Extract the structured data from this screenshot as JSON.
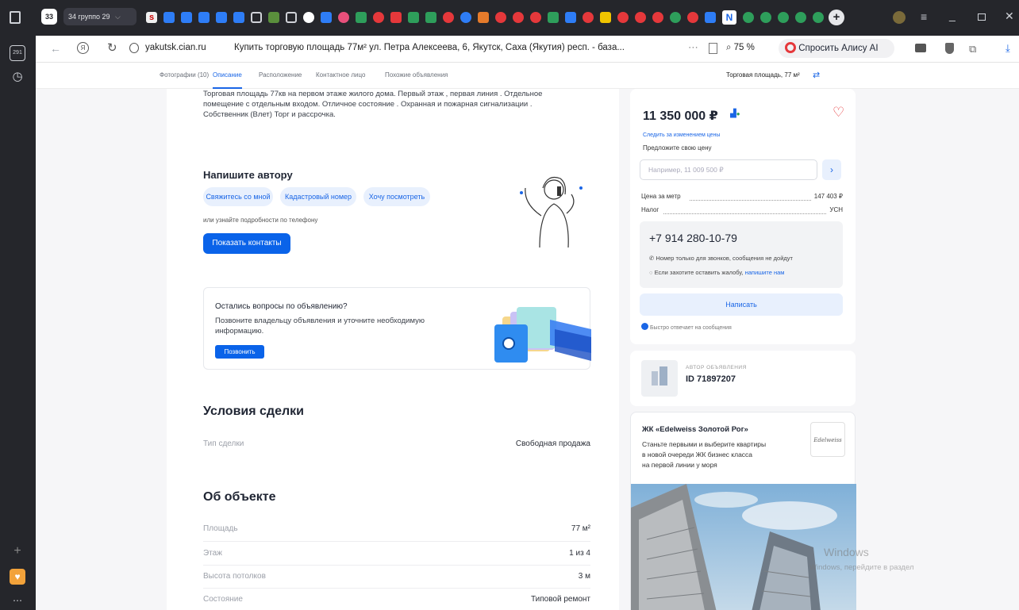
{
  "browser": {
    "tab_group": "34 группо 29",
    "tab_count": "33",
    "sidebar_badge": "291",
    "url": "yakutsk.cian.ru",
    "page_title": "Купить торговую площадь 77м² ул. Петра Алексеева, 6, Якутск, Саха (Якутия) респ. - база...",
    "zoom": "75 %",
    "alice_button": "Спросить Алису AI"
  },
  "subnav": {
    "links": [
      "Фотографии (10)",
      "Описание",
      "Расположение",
      "Контактное лицо",
      "Похожие объявления"
    ],
    "right_label": "Торговая площадь, 77 м²"
  },
  "description": {
    "text_line1": "Торговая площадь 77кв  на первом этаже жилого дома. Первый этаж , первая линия . Отдельное",
    "text_line2": "помещение с отдельным входом. Отличное состояние . Охранная и пожарная сигнализации .",
    "text_line3": "Собственник (Влет) Торг и рассрочка."
  },
  "write_author": {
    "title": "Напишите автору",
    "chips": [
      "Свяжитесь со мной",
      "Кадастровый номер",
      "Хочу посмотреть"
    ],
    "hint": "или узнайте подробности по телефону",
    "show_contacts": "Показать контакты"
  },
  "questions": {
    "title": "Остались вопросы по объявлению?",
    "text_line1": "Позвоните владельцу объявления и уточните необходимую",
    "text_line2": "информацию.",
    "call_button": "Позвонить"
  },
  "deal": {
    "title": "Условия сделки",
    "rows": [
      {
        "label": "Тип сделки",
        "value": "Свободная продажа"
      }
    ]
  },
  "object": {
    "title": "Об объекте",
    "rows": [
      {
        "label": "Площадь",
        "value": "77 м²"
      },
      {
        "label": "Этаж",
        "value": "1 из 4"
      },
      {
        "label": "Высота потолков",
        "value": "3 м"
      },
      {
        "label": "Состояние",
        "value": "Типовой ремонт"
      }
    ]
  },
  "price_card": {
    "price": "11 350 000 ₽",
    "follow_price": "Следить за изменением цены",
    "offer_label": "Предложите свою цену",
    "offer_placeholder": "Например, 11 009 500 ₽",
    "per_meter_label": "Цена за метр",
    "per_meter_value": "147 403 ₽",
    "tax_label": "Налог",
    "tax_value": "УСН",
    "phone": "+7 914 280-10-79",
    "phone_note1": "Номер только для звонков, сообщения не дойдут",
    "phone_note2_a": "Если захотите оставить жалобу,",
    "phone_note2_link": "напишите нам",
    "write_button": "Написать",
    "fast_reply": "Быстро отвечает на сообщения"
  },
  "author_card": {
    "caption": "АВТОР ОБЪЯВЛЕНИЯ",
    "id": "ID 71897207"
  },
  "ad_card": {
    "title": "ЖК «Edelweiss Золотой Рог»",
    "text_line1": "Станьте первыми и выберите квартиры",
    "text_line2": "в новой очереди ЖК бизнес класса",
    "text_line3": "на первой линии у моря",
    "logo": "Edelweiss"
  },
  "watermark": {
    "line1": "Windows",
    "line2": "Windows, перейдите в раздел"
  },
  "colors": {
    "accent": "#0a63e9",
    "chip_bg": "#e8f0fd",
    "heart": "#e5383b",
    "dark": "#25262b"
  }
}
